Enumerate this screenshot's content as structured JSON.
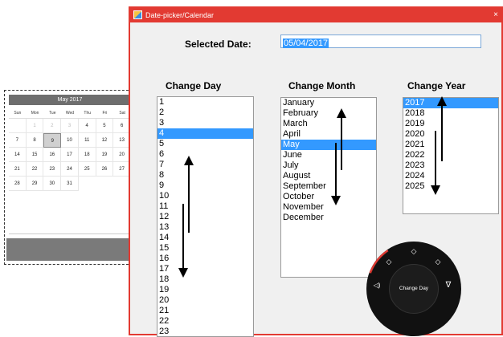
{
  "calendar": {
    "month_label": "May 2017",
    "weekdays": [
      "Sun",
      "Mon",
      "Tue",
      "Wed",
      "Thu",
      "Fri",
      "Sat"
    ],
    "days": [
      "",
      "1",
      "2",
      "3",
      "4",
      "5",
      "6",
      "7",
      "8",
      "9",
      "10",
      "11",
      "12",
      "13",
      "14",
      "15",
      "16",
      "17",
      "18",
      "19",
      "20",
      "21",
      "22",
      "23",
      "24",
      "25",
      "26",
      "27",
      "28",
      "29",
      "30",
      "31"
    ],
    "faint_days": [
      "1",
      "2",
      "3"
    ],
    "selected_day": "9"
  },
  "window": {
    "title": "Date-picker/Calendar",
    "close_glyph": "×"
  },
  "selected_date": {
    "label": "Selected Date:",
    "value": "05/04/2017"
  },
  "columns": {
    "day": {
      "title": "Change Day",
      "items": [
        "1",
        "2",
        "3",
        "4",
        "5",
        "6",
        "7",
        "8",
        "9",
        "10",
        "11",
        "12",
        "13",
        "14",
        "15",
        "16",
        "17",
        "18",
        "19",
        "20",
        "21",
        "22",
        "23"
      ],
      "selected": "4"
    },
    "month": {
      "title": "Change Month",
      "items": [
        "January",
        "February",
        "March",
        "April",
        "May",
        "June",
        "July",
        "August",
        "September",
        "October",
        "November",
        "December"
      ],
      "selected": "May"
    },
    "year": {
      "title": "Change Year",
      "items": [
        "2017",
        "2018",
        "2019",
        "2020",
        "2021",
        "2022",
        "2023",
        "2024",
        "2025"
      ],
      "selected": "2017"
    }
  },
  "dial": {
    "center_label": "Change Day",
    "icons": [
      "chevron-up-icon",
      "chevron-up-icon",
      "chevron-up-icon",
      "volume-icon",
      "filter-icon"
    ]
  },
  "colors": {
    "accent_red": "#e23a32",
    "selection_blue": "#3399ff"
  }
}
